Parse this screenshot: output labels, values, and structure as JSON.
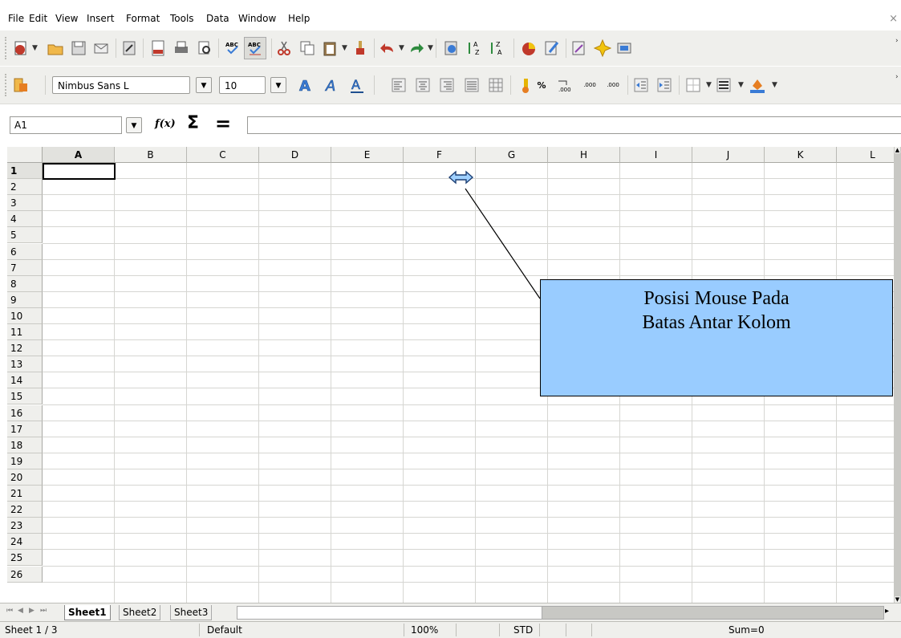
{
  "menu": [
    "File",
    "Edit",
    "View",
    "Insert",
    "Format",
    "Tools",
    "Data",
    "Window",
    "Help"
  ],
  "menu_close": "×",
  "toolbar2": {
    "font_name": "Nimbus Sans L",
    "font_size": "10",
    "percent_label": "%",
    "decimal_add_label": ".000",
    "decimal_del_label": ".000"
  },
  "formula": {
    "name_box": "A1",
    "fx_label": "f(x)",
    "sum_label": "Σ",
    "equal_label": "=",
    "input_value": ""
  },
  "columns": [
    "A",
    "B",
    "C",
    "D",
    "E",
    "F",
    "G",
    "H",
    "I",
    "J",
    "K",
    "L"
  ],
  "rows": [
    "1",
    "2",
    "3",
    "4",
    "5",
    "6",
    "7",
    "8",
    "9",
    "10",
    "11",
    "12",
    "13",
    "14",
    "15",
    "16",
    "17",
    "18",
    "19",
    "20",
    "21",
    "22",
    "23",
    "24",
    "25",
    "26"
  ],
  "sheet_tabs": [
    "Sheet1",
    "Sheet2",
    "Sheet3"
  ],
  "status": {
    "sheet": "Sheet 1 / 3",
    "style": "Default",
    "zoom": "100%",
    "mode": "STD",
    "sum": "Sum=0"
  },
  "callout": {
    "line1": "Posisi Mouse Pada",
    "line2": "Batas Antar Kolom"
  },
  "colors": {
    "toolbar_bg": "#efefec",
    "callout_bg": "#99ccff",
    "cursor_icon": "#5b9bd5"
  }
}
